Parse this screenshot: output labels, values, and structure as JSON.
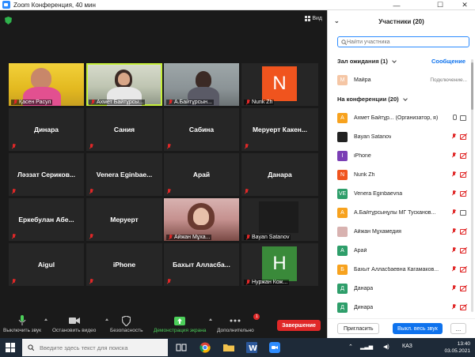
{
  "window": {
    "title": "Zoom Конференция, 40 мин",
    "minimize": "—",
    "maximize": "☐",
    "close": "✕"
  },
  "video": {
    "view_label": "Вид",
    "tiles": [
      {
        "label": "Қасен Расул",
        "type": "photo"
      },
      {
        "label": "Ахмет Байтұрсы...",
        "type": "photo",
        "active": true
      },
      {
        "label": "А.Байтұрсын...",
        "type": "photo"
      },
      {
        "label": "Nurik Zh",
        "type": "avatar",
        "letter": "N",
        "color": "#f0541e"
      },
      {
        "name": "Динара"
      },
      {
        "name": "Сания"
      },
      {
        "name": "Сабина"
      },
      {
        "name": "Меруерт  Какен..."
      },
      {
        "name": "Ләззат  Сериков..."
      },
      {
        "name": "Venera  Eginbae..."
      },
      {
        "name": "Арай"
      },
      {
        "name": "Данара"
      },
      {
        "name": "Еркебулан  Абе..."
      },
      {
        "name": "Меруерт"
      },
      {
        "label": "Айжан Мұха...",
        "type": "photo"
      },
      {
        "label": "Bayan Satanov",
        "type": "dark"
      },
      {
        "name": "Aigul"
      },
      {
        "name": "iPhone"
      },
      {
        "name": "Бахыт  Алласба..."
      },
      {
        "label": "Нуржан Кож...",
        "type": "avatar",
        "letter": "H",
        "color": "#3a8a3a"
      }
    ]
  },
  "toolbar": {
    "mute": "Выключить звук",
    "stop_video": "Остановить видео",
    "security": "Безопасность",
    "share": "Демонстрация экрана",
    "more": "Дополнительно",
    "more_badge": "1",
    "end": "Завершение"
  },
  "panel": {
    "title": "Участники (20)",
    "search_placeholder": "Найти участника",
    "waiting_room": "Зал ожидания (1)",
    "message": "Сообщение",
    "waiting": [
      {
        "initial": "М",
        "name": "Майра",
        "status": "Подключение...",
        "color": "#f5c6a5"
      }
    ],
    "in_meeting": "На конференции (20)",
    "participants": [
      {
        "initial": "А",
        "name": "Ахмет Байтұр... (Организатор, я)",
        "color": "#f7a21e",
        "icons": "on"
      },
      {
        "initial": "",
        "name": "Bayan Satanov",
        "color": "#222222",
        "icons": "off"
      },
      {
        "initial": "I",
        "name": "iPhone",
        "color": "#7b3fb5",
        "icons": "off"
      },
      {
        "initial": "N",
        "name": "Nurik Zh",
        "color": "#f0541e",
        "icons": "off"
      },
      {
        "initial": "VE",
        "name": "Venera Eginbaevna",
        "color": "#2e9e6a",
        "icons": "off"
      },
      {
        "initial": "А",
        "name": "А.Байтұрсынұлы МГ Тусканов...",
        "color": "#f7a21e",
        "icons": "mixed"
      },
      {
        "initial": "",
        "name": "Айжан Мұхамедия",
        "color": "#d8b2b0",
        "icons": "off"
      },
      {
        "initial": "А",
        "name": "Арай",
        "color": "#2e9e6a",
        "icons": "off"
      },
      {
        "initial": "Б",
        "name": "Бахыт Алласбаевна Кагамаков...",
        "color": "#f7a21e",
        "icons": "off"
      },
      {
        "initial": "Д",
        "name": "Данара",
        "color": "#2e9e6a",
        "icons": "off"
      },
      {
        "initial": "Д",
        "name": "Динара",
        "color": "#2e9e6a",
        "icons": "off"
      }
    ],
    "invite": "Пригласить",
    "mute_all": "Выкл. весь звук",
    "more": "..."
  },
  "taskbar": {
    "search_placeholder": "Введите здесь текст для поиска",
    "lang": "КАЗ",
    "time": "13:40",
    "date": "03.05.2021"
  }
}
